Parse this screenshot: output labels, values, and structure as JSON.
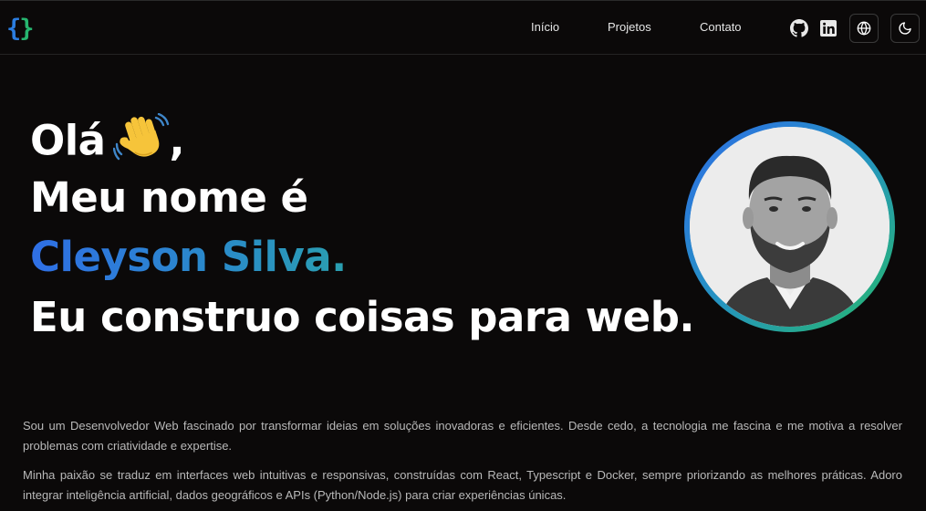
{
  "header": {
    "logo": {
      "left": "{",
      "right": "}"
    },
    "nav": [
      {
        "label": "Início"
      },
      {
        "label": "Projetos"
      },
      {
        "label": "Contato"
      }
    ],
    "icons": [
      "github-icon",
      "linkedin-icon",
      "globe-icon",
      "moon-icon"
    ]
  },
  "hero": {
    "greeting": "Olá",
    "greeting_suffix": ",",
    "line2": "Meu nome é",
    "name": "Cleyson Silva.",
    "line4": "Eu construo coisas para web."
  },
  "about": {
    "p1": "Sou um Desenvolvedor Web fascinado por transformar ideias em soluções inovadoras e eficientes. Desde cedo, a tecnologia me fascina e me motiva a resolver problemas com criatividade e expertise.",
    "p2": "Minha paixão se traduz em interfaces web intuitivas e responsivas, construídas com React, Typescript e Docker, sempre priorizando as melhores práticas. Adoro integrar inteligência artificial, dados geográficos e APIs (Python/Node.js) para criar experiências únicas."
  },
  "colors": {
    "background": "#0b0909",
    "accent_blue": "#2f6fe6",
    "accent_green": "#27b96a",
    "text_muted": "#b9b9b9"
  }
}
